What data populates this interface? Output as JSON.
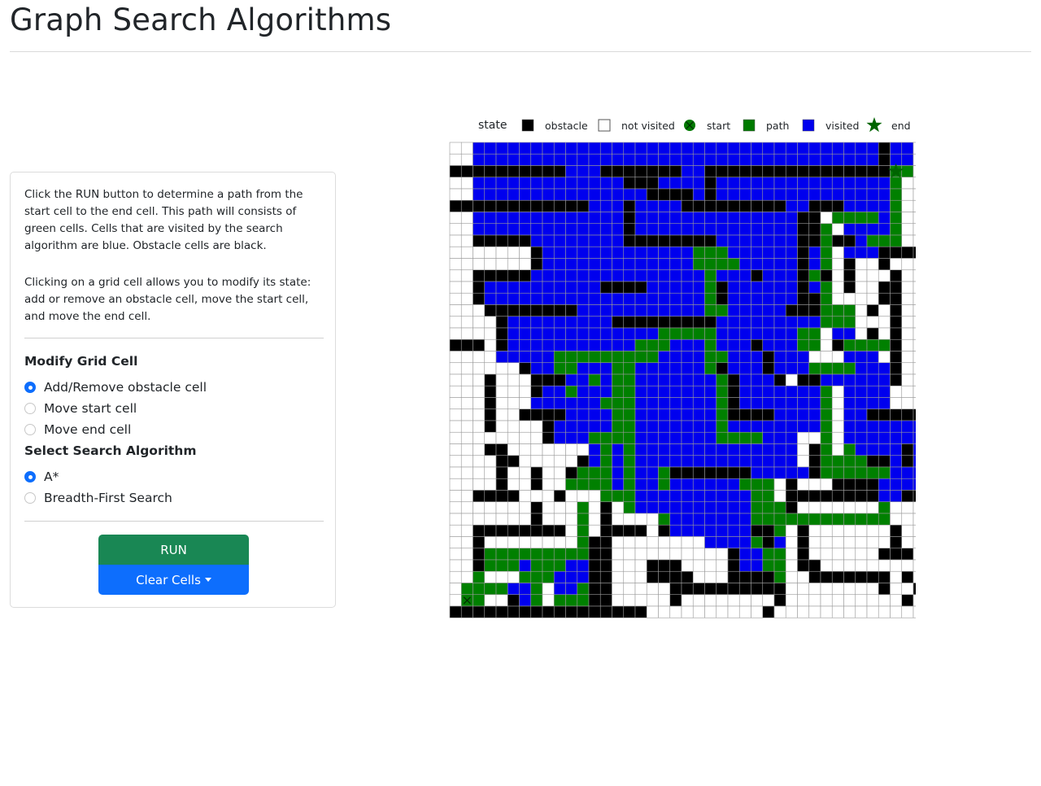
{
  "page": {
    "title": "Graph Search Algorithms"
  },
  "sidebar": {
    "description_1": "Click the RUN button to determine a path from the start cell to the end cell. This path will consists of green cells. Cells that are visited by the search algorithm are blue. Obstacle cells are black.",
    "description_2": "Clicking on a grid cell allows you to modify its state: add or remove an obstacle cell, move the start cell, and move the end cell.",
    "modify_heading": "Modify Grid Cell",
    "modify_options": [
      {
        "label": "Add/Remove obstacle cell",
        "checked": true
      },
      {
        "label": "Move start cell",
        "checked": false
      },
      {
        "label": "Move end cell",
        "checked": false
      }
    ],
    "algorithm_heading": "Select Search Algorithm",
    "algorithm_options": [
      {
        "label": "A*",
        "checked": true
      },
      {
        "label": "Breadth-First Search",
        "checked": false
      }
    ],
    "run_label": "RUN",
    "clear_label": "Clear Cells"
  },
  "legend": {
    "title": "state",
    "items": [
      {
        "label": "obstacle",
        "symbol": "square",
        "color": "#000000"
      },
      {
        "label": "not visited",
        "symbol": "square-outline",
        "color": "#ffffff"
      },
      {
        "label": "start",
        "symbol": "circle-x",
        "color": "#007a00"
      },
      {
        "label": "path",
        "symbol": "square",
        "color": "#007a00"
      },
      {
        "label": "visited",
        "symbol": "square",
        "color": "#0000ee"
      },
      {
        "label": "end",
        "symbol": "star",
        "color": "#006400"
      }
    ]
  },
  "colors": {
    "obstacle": "#000000",
    "not_visited": "#ffffff",
    "path": "#008000",
    "visited": "#0000ee",
    "start": "#007a00",
    "end": "#006400",
    "grid_line": "#9a9a9a"
  },
  "grid": {
    "rows": 41,
    "cols": 41,
    "legend_codes": "0 not visited, 1 obstacle, 2 visited, 3 path",
    "start": {
      "row": 39,
      "col": 1
    },
    "end": {
      "row": 2,
      "col": 38
    },
    "cells": [
      "00222222222222222222222222222222222221220",
      "00222222222222222222222222222222222221220",
      "11111111112221111111221111111111111111330",
      "00222222222222211122221222222222222222300",
      "00222222222222222111121222222222222222300",
      "11111111111122212222111111111221112222300",
      "00222222222222212222222222222211033332300",
      "00222222222222212222222222222211302222300",
      "00111112222222211111111222222211311233300",
      "00000001222222222222233322222212302221111",
      "00000001222222222222233332222212301001000",
      "00111112222222222222223222122213101000100",
      "00122222222221111222223122222212301001100",
      "00122222222222222222223122222211300001100",
      "00011111111222222222223322222111333010100",
      "00001222222222111111111222222222333000100",
      "00001222222222222233333222222233022010100",
      "11101222222222223332223222122233013333100",
      "00002222233333333322223322212220002220100",
      "00000012233222332222223122212223333222100",
      "00010001112232332222222312221011222222100",
      "00010001223222332222222312222222302222000",
      "00010002222223332222222312222222302222000",
      "00010011112222332222222311112222302211111",
      "00010000122222332222222322222222302222222",
      "00000000122233332222222333322200302222222",
      "00011000000023232222222222222201303222212",
      "00001100000123232222222222222201333311212",
      "00001001001333232231111111222221333333222",
      "00001001003333232232222223330100011112222",
      "00111100010003332222222222330111111112211",
      "00000001000301032222222222333100000003000",
      "00000001000301000032222222333333333333000",
      "00111111110301111012222222113010000000100",
      "00100000000311000000002222312010000000100",
      "00133333333311000000000012233010000001110",
      "00133323332211000111000012233011000000000",
      "00300033322211000111100011113001111111010",
      "03333223022311000001111111111000000001001",
      "03300123033311000001000000001000000000010",
      "11111111111111111000000000010000000000000"
    ]
  }
}
